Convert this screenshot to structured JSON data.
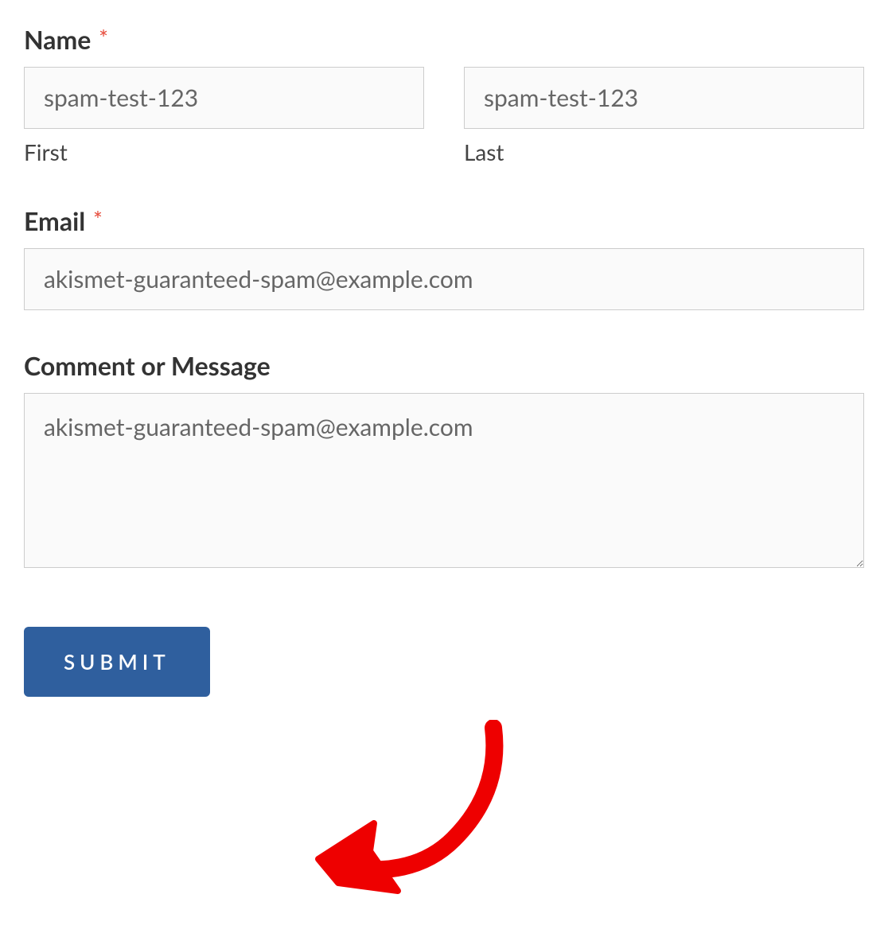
{
  "form": {
    "name": {
      "label": "Name",
      "required_marker": "*",
      "first": {
        "value": "spam-test-123",
        "sublabel": "First"
      },
      "last": {
        "value": "spam-test-123",
        "sublabel": "Last"
      }
    },
    "email": {
      "label": "Email",
      "required_marker": "*",
      "value": "akismet-guaranteed-spam@example.com"
    },
    "comment": {
      "label": "Comment or Message",
      "value": "akismet-guaranteed-spam@example.com"
    },
    "submit": {
      "label": "SUBMIT"
    }
  }
}
